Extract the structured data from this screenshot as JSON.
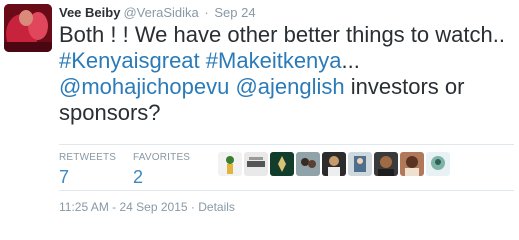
{
  "tweet": {
    "fullname": "Vee Beiby",
    "username": "@VeraSidika",
    "separator": "·",
    "date": "Sep 24",
    "text_parts": [
      {
        "text": "Both ! ! We have other better things to watch.. ",
        "kind": "plain"
      },
      {
        "text": "#Kenyaisgreat",
        "kind": "link"
      },
      {
        "text": " ",
        "kind": "plain"
      },
      {
        "text": "#Makeitkenya",
        "kind": "link"
      },
      {
        "text": "... ",
        "kind": "plain"
      },
      {
        "text": "@mohajichopevu",
        "kind": "link"
      },
      {
        "text": " ",
        "kind": "plain"
      },
      {
        "text": "@ajenglish",
        "kind": "link"
      },
      {
        "text": " investors or sponsors?",
        "kind": "plain"
      }
    ],
    "stats": {
      "retweets_label": "RETWEETS",
      "retweets_count": "7",
      "favorites_label": "FAVORITES",
      "favorites_count": "2"
    },
    "favoriters": [
      "user-avatar-1",
      "user-avatar-2",
      "user-avatar-3",
      "user-avatar-4",
      "user-avatar-5",
      "user-avatar-6",
      "user-avatar-7",
      "user-avatar-8",
      "user-avatar-9"
    ],
    "footer": {
      "timestamp": "11:25 AM - 24 Sep 2015",
      "separator": "·",
      "details_label": "Details"
    }
  },
  "colors": {
    "text": "#292f33",
    "muted": "#8899a6",
    "link": "#2b7bb9",
    "count": "#3b88c3",
    "divider": "#e1e8ed"
  }
}
